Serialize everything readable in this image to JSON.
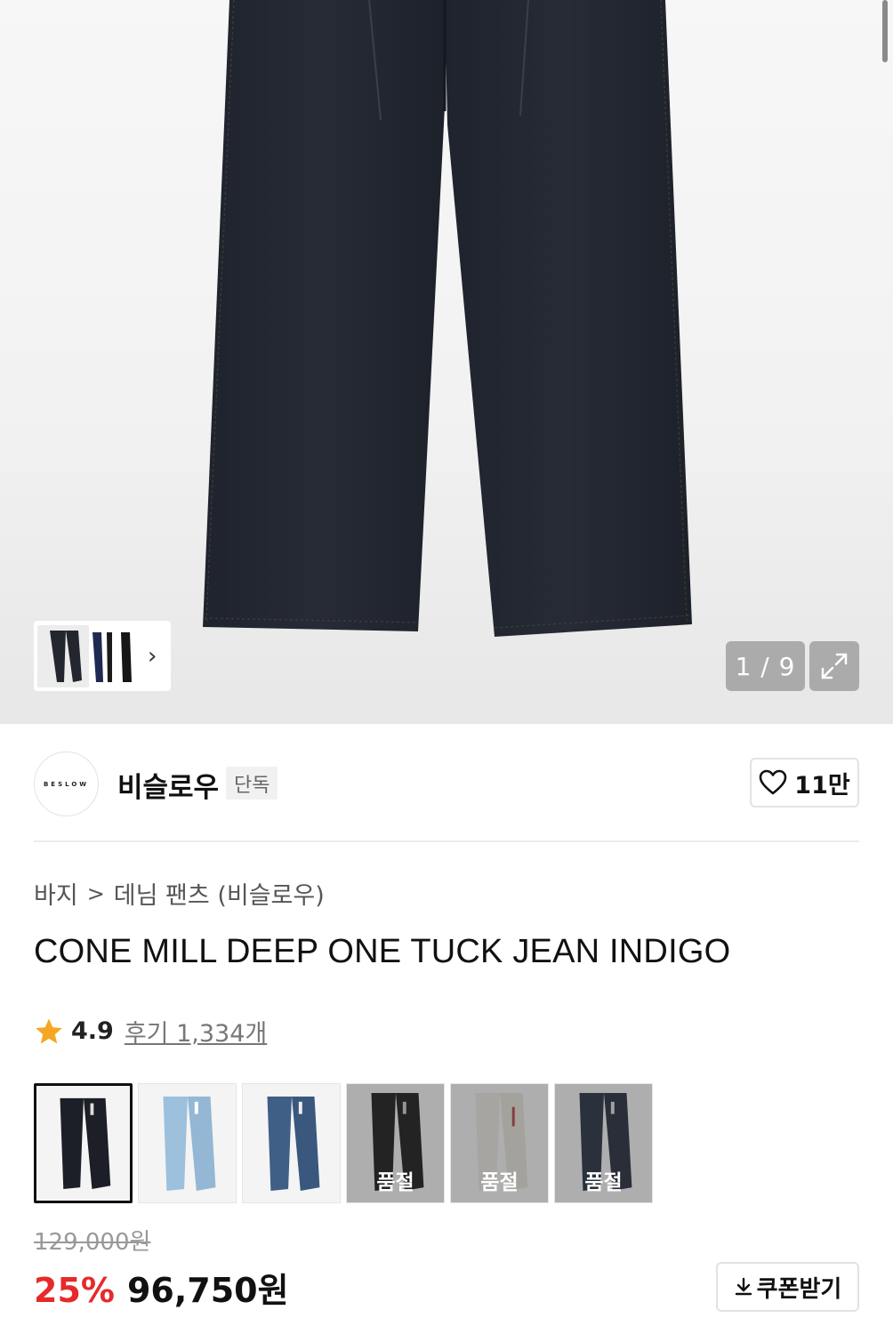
{
  "gallery": {
    "counter": "1 / 9",
    "icons": {
      "expand": "expand-arrows-icon",
      "next": "chevron-right-icon"
    }
  },
  "brand": {
    "logo_text": "BESLOW",
    "name": "비슬로우",
    "tag": "단독",
    "like_count": "11만",
    "like_icon": "heart-outline-icon"
  },
  "breadcrumb": {
    "items": [
      "바지",
      "데님 팬츠 (비슬로우)"
    ],
    "separator": ">"
  },
  "product": {
    "title": "CONE MILL DEEP ONE TUCK JEAN INDIGO",
    "rating": "4.9",
    "review_label": "후기 1,334개",
    "original_price": "129,000원",
    "discount": "25%",
    "sale_price": "96,750원"
  },
  "swatches": [
    {
      "name": "indigo-black",
      "color": "#1c1f27",
      "selected": true,
      "sold_out": false
    },
    {
      "name": "light-blue",
      "color": "#9dc0dc",
      "selected": false,
      "sold_out": false
    },
    {
      "name": "mid-blue",
      "color": "#3f5f86",
      "selected": false,
      "sold_out": false
    },
    {
      "name": "black",
      "color": "#141414",
      "selected": false,
      "sold_out": true,
      "label": "품절"
    },
    {
      "name": "ecru",
      "color": "#e8e6df",
      "selected": false,
      "sold_out": true,
      "label": "품절"
    },
    {
      "name": "deep-navy",
      "color": "#202a3d",
      "selected": false,
      "sold_out": true,
      "label": "품절"
    }
  ],
  "coupon": {
    "label": "쿠폰받기",
    "icon": "download-icon"
  },
  "colors": {
    "accent_red": "#e62a2a",
    "star": "#f5a623"
  }
}
